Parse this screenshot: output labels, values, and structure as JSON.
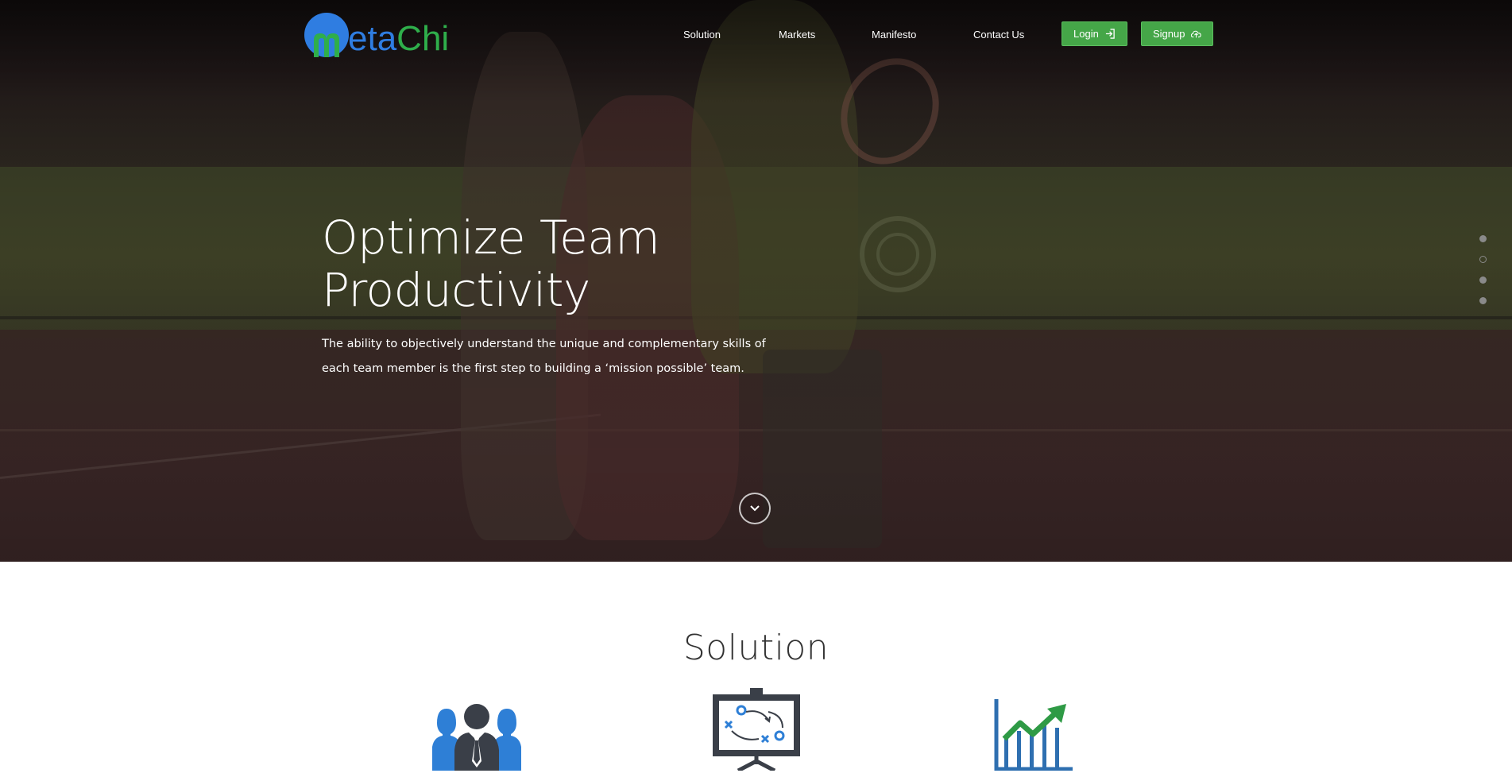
{
  "brand": {
    "logo_letter": "m",
    "logo_rest_a": "eta",
    "logo_rest_b": "Chi",
    "colors": {
      "blue": "#2f7de1",
      "green": "#2fae4b"
    }
  },
  "nav": {
    "items": [
      "Solution",
      "Markets",
      "Manifesto",
      "Contact Us"
    ],
    "login_label": "Login",
    "signup_label": "Signup",
    "button_color": "#45a648"
  },
  "hero": {
    "title_line1": "Optimize Team",
    "title_line2": "Productivity",
    "subtitle": "The ability to objectively understand the unique and complementary skills of each team member is the first step to building a ‘mission possible’ team.",
    "slides": {
      "count": 4,
      "active_index": 0
    }
  },
  "solution": {
    "heading": "Solution",
    "icons": [
      "team-icon",
      "strategy-board-icon",
      "growth-chart-icon"
    ]
  }
}
